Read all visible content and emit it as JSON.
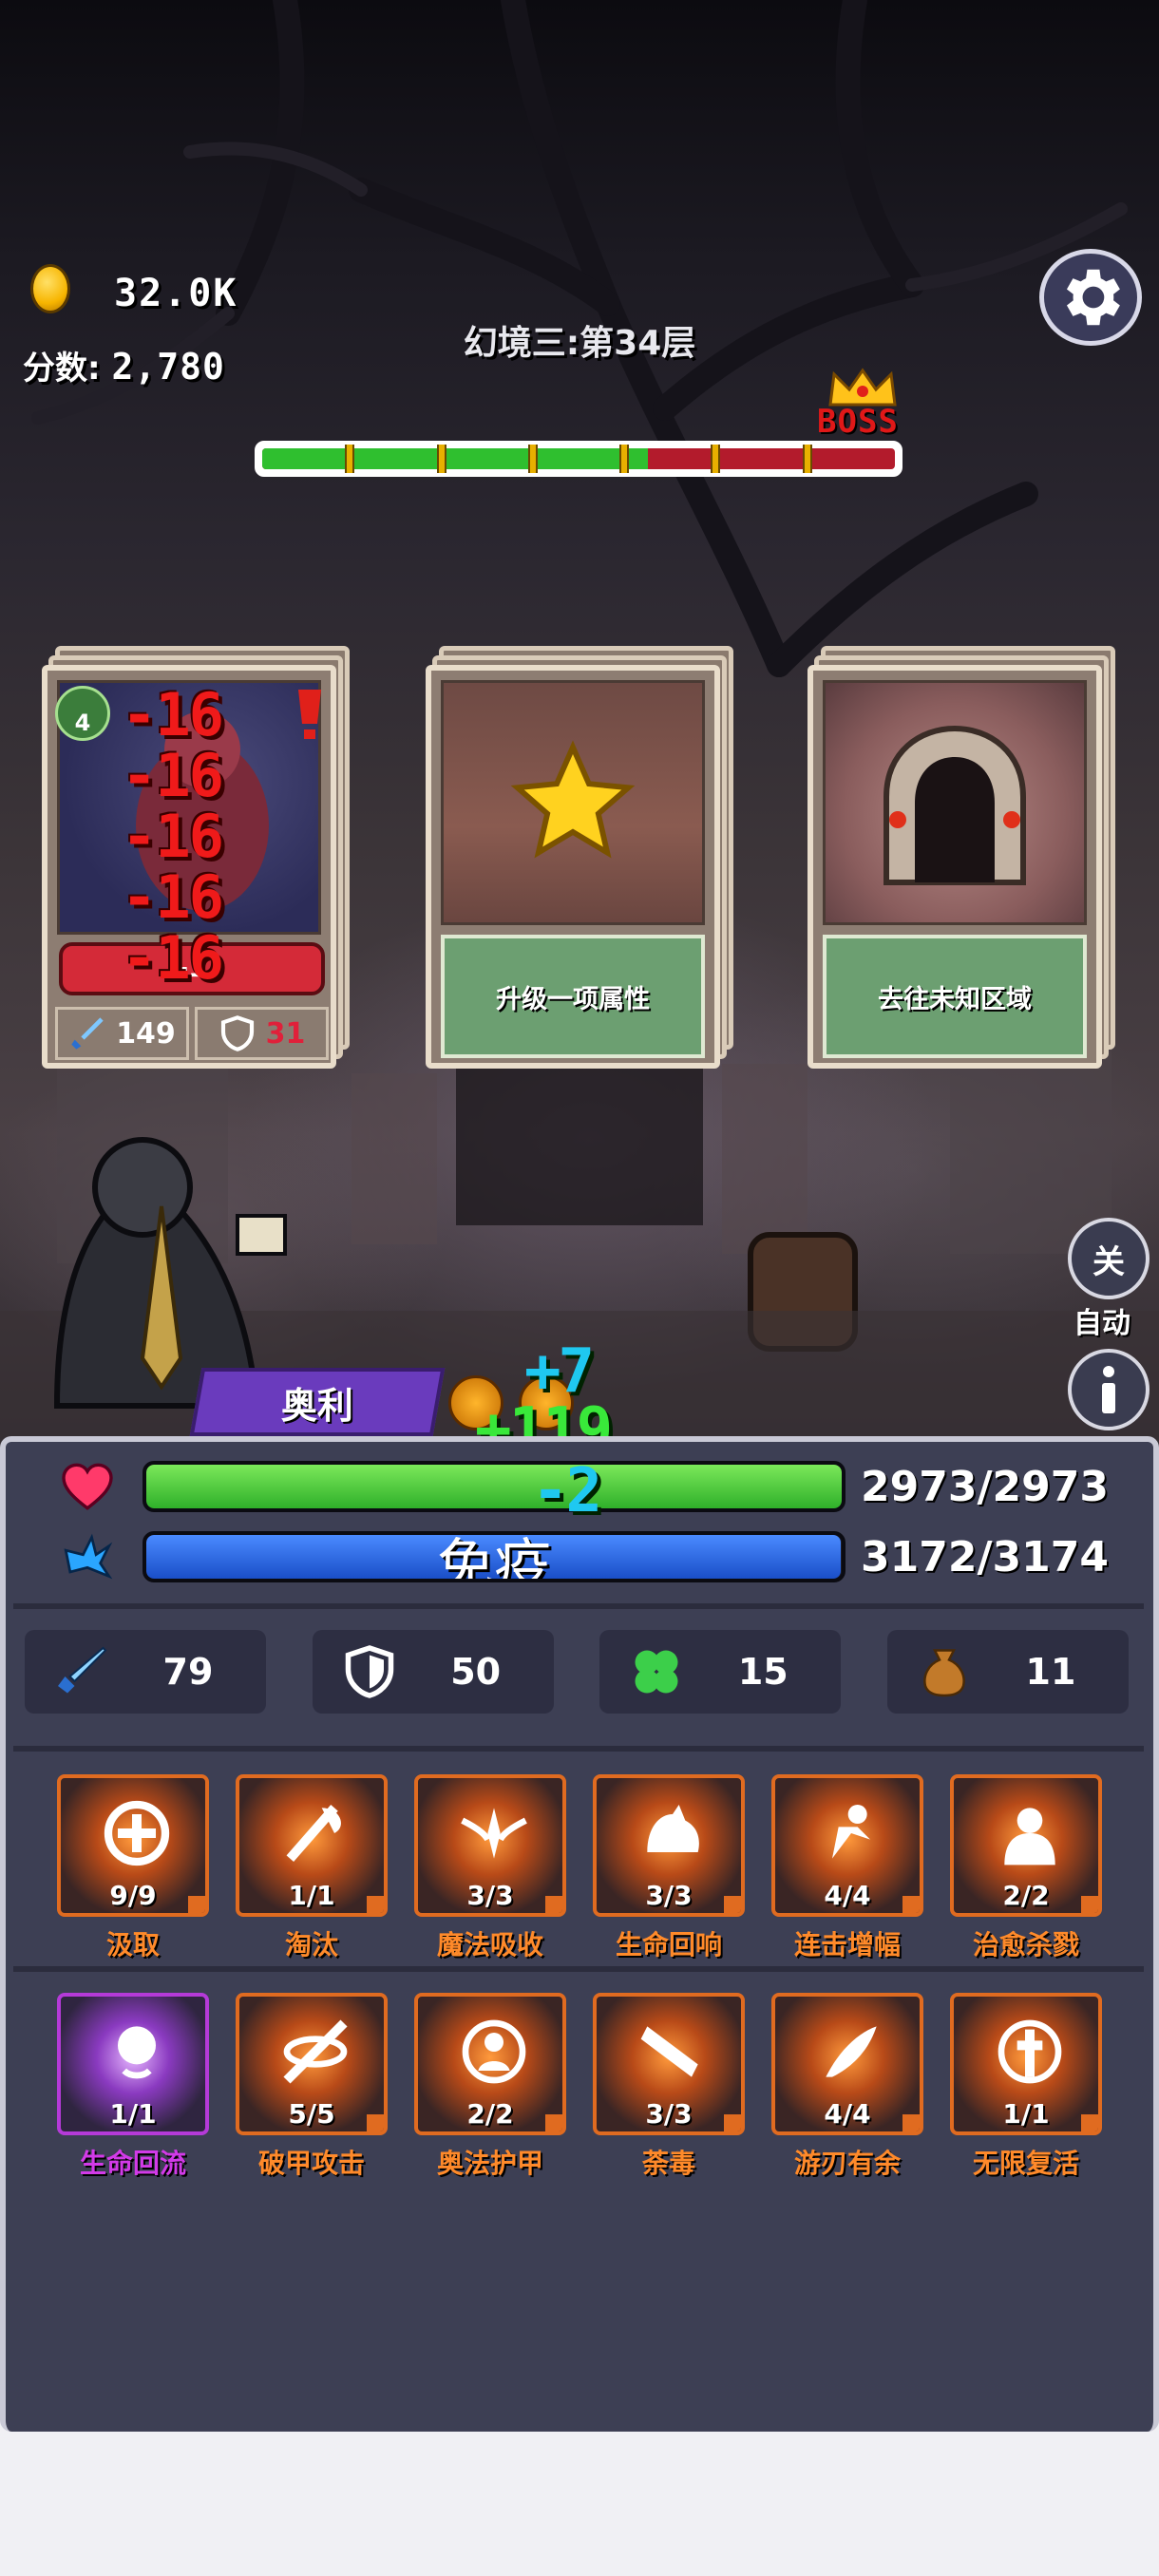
{
  "header": {
    "coins": "32.0K",
    "score_label": "分数:",
    "score_value": "2,780",
    "stage_title": "幻境三:第34层",
    "boss_label": "BOSS"
  },
  "progress": {
    "ratio": 0.61,
    "segments": 7
  },
  "cards": {
    "enemy": {
      "level": "4",
      "damage_numbers": [
        "-16",
        "-16",
        "-16",
        "-16",
        "-16"
      ],
      "hp_text": "-1 ",
      "attack": "149",
      "defense": "31"
    },
    "upgrade": {
      "caption": "升级一项属性"
    },
    "explore": {
      "caption": "去往未知区域"
    }
  },
  "hero": {
    "name": "奥利",
    "float_plus7": "+7",
    "float_plus119": "+119",
    "float_minus2": "-2"
  },
  "controls": {
    "close_label": "关",
    "auto_label": "自动",
    "info_label": "i"
  },
  "player": {
    "hp_text": "2973/2973",
    "hp_ratio": 1.0,
    "mp_text": "3172/3174",
    "mp_ratio": 0.999,
    "status_text": "免疫"
  },
  "stats": [
    {
      "name": "attack",
      "value": "79"
    },
    {
      "name": "defense",
      "value": "50"
    },
    {
      "name": "luck",
      "value": "15"
    },
    {
      "name": "bag",
      "value": "11"
    }
  ],
  "skills_row1": [
    {
      "name": "汲取",
      "level": "9/9"
    },
    {
      "name": "淘汰",
      "level": "1/1"
    },
    {
      "name": "魔法吸收",
      "level": "3/3"
    },
    {
      "name": "生命回响",
      "level": "3/3"
    },
    {
      "name": "连击增幅",
      "level": "4/4"
    },
    {
      "name": "治愈杀戮",
      "level": "2/2"
    }
  ],
  "skills_row2": [
    {
      "name": "生命回流",
      "level": "1/1"
    },
    {
      "name": "破甲攻击",
      "level": "5/5"
    },
    {
      "name": "奥法护甲",
      "level": "2/2"
    },
    {
      "name": "荼毒",
      "level": "3/3"
    },
    {
      "name": "游刃有余",
      "level": "4/4"
    },
    {
      "name": "无限复活",
      "level": "1/1"
    }
  ],
  "colors": {
    "hp": "#3fc93a",
    "mp": "#1f5fd8",
    "skill_orange": "#ff8a2a",
    "skill_purple": "#d23ae8",
    "boss_red": "#e01818"
  }
}
